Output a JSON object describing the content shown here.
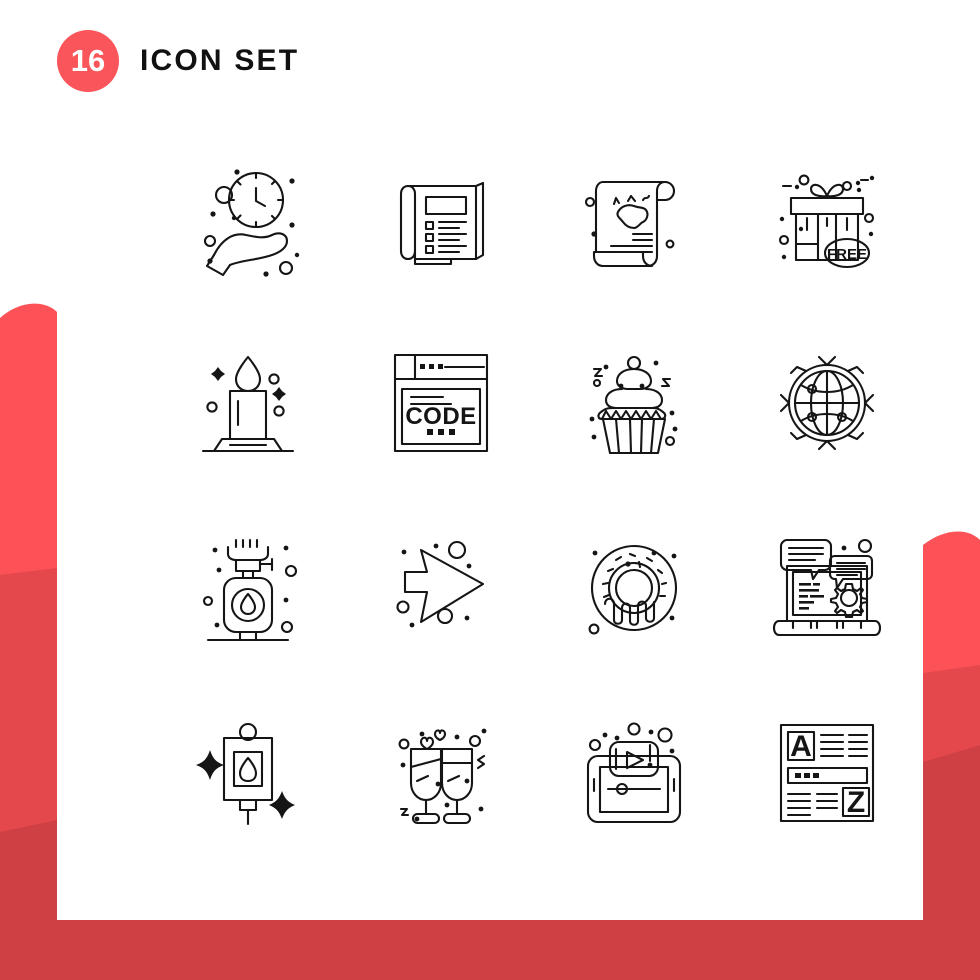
{
  "page": {
    "background_color": "#ffffff",
    "card_color": "#ffffff"
  },
  "decor": {
    "accent_light": "#fc5257",
    "accent_mid": "#e4484c",
    "accent_dark": "#cf4044",
    "description": "layered red ribbon shapes on left and right edges and bottom"
  },
  "header": {
    "count": "16",
    "badge_color": "#f9555a",
    "title": "ICON SET"
  },
  "grid": {
    "columns": 4,
    "rows": 4,
    "total": 16,
    "stroke_color": "#151515"
  },
  "icons": [
    {
      "index": 1,
      "name": "hand-holding-clock-icon",
      "label": "Time Management",
      "row": 1,
      "col": 1
    },
    {
      "index": 2,
      "name": "catalog-booklet-icon",
      "label": "Catalog",
      "row": 1,
      "col": 2
    },
    {
      "index": 3,
      "name": "australia-scroll-icon",
      "label": "Australia Scroll",
      "row": 1,
      "col": 3
    },
    {
      "index": 4,
      "name": "free-gift-box-icon",
      "label": "Free Gift",
      "row": 1,
      "col": 4,
      "text": "FREE"
    },
    {
      "index": 5,
      "name": "candle-icon",
      "label": "Candle",
      "row": 2,
      "col": 1
    },
    {
      "index": 6,
      "name": "code-browser-window-icon",
      "label": "Code",
      "row": 2,
      "col": 2,
      "text": "CODE"
    },
    {
      "index": 7,
      "name": "cupcake-icon",
      "label": "Cupcake",
      "row": 2,
      "col": 3
    },
    {
      "index": 8,
      "name": "global-network-icon",
      "label": "Global Network",
      "row": 2,
      "col": 4
    },
    {
      "index": 9,
      "name": "gas-cylinder-stove-icon",
      "label": "Gas Stove",
      "row": 3,
      "col": 1
    },
    {
      "index": 10,
      "name": "arrow-right-icon",
      "label": "Arrow Right",
      "row": 3,
      "col": 2
    },
    {
      "index": 11,
      "name": "donut-icon",
      "label": "Donut",
      "row": 3,
      "col": 3
    },
    {
      "index": 12,
      "name": "laptop-support-chat-icon",
      "label": "Tech Support",
      "row": 3,
      "col": 4
    },
    {
      "index": 13,
      "name": "iv-drip-bag-icon",
      "label": "IV Drip",
      "row": 4,
      "col": 1
    },
    {
      "index": 14,
      "name": "champagne-toast-icon",
      "label": "Cheers",
      "row": 4,
      "col": 2
    },
    {
      "index": 15,
      "name": "tablet-video-player-icon",
      "label": "Video Player",
      "row": 4,
      "col": 3
    },
    {
      "index": 16,
      "name": "dictionary-page-icon",
      "label": "Dictionary",
      "row": 4,
      "col": 4,
      "text_a": "A",
      "text_z": "Z"
    }
  ]
}
